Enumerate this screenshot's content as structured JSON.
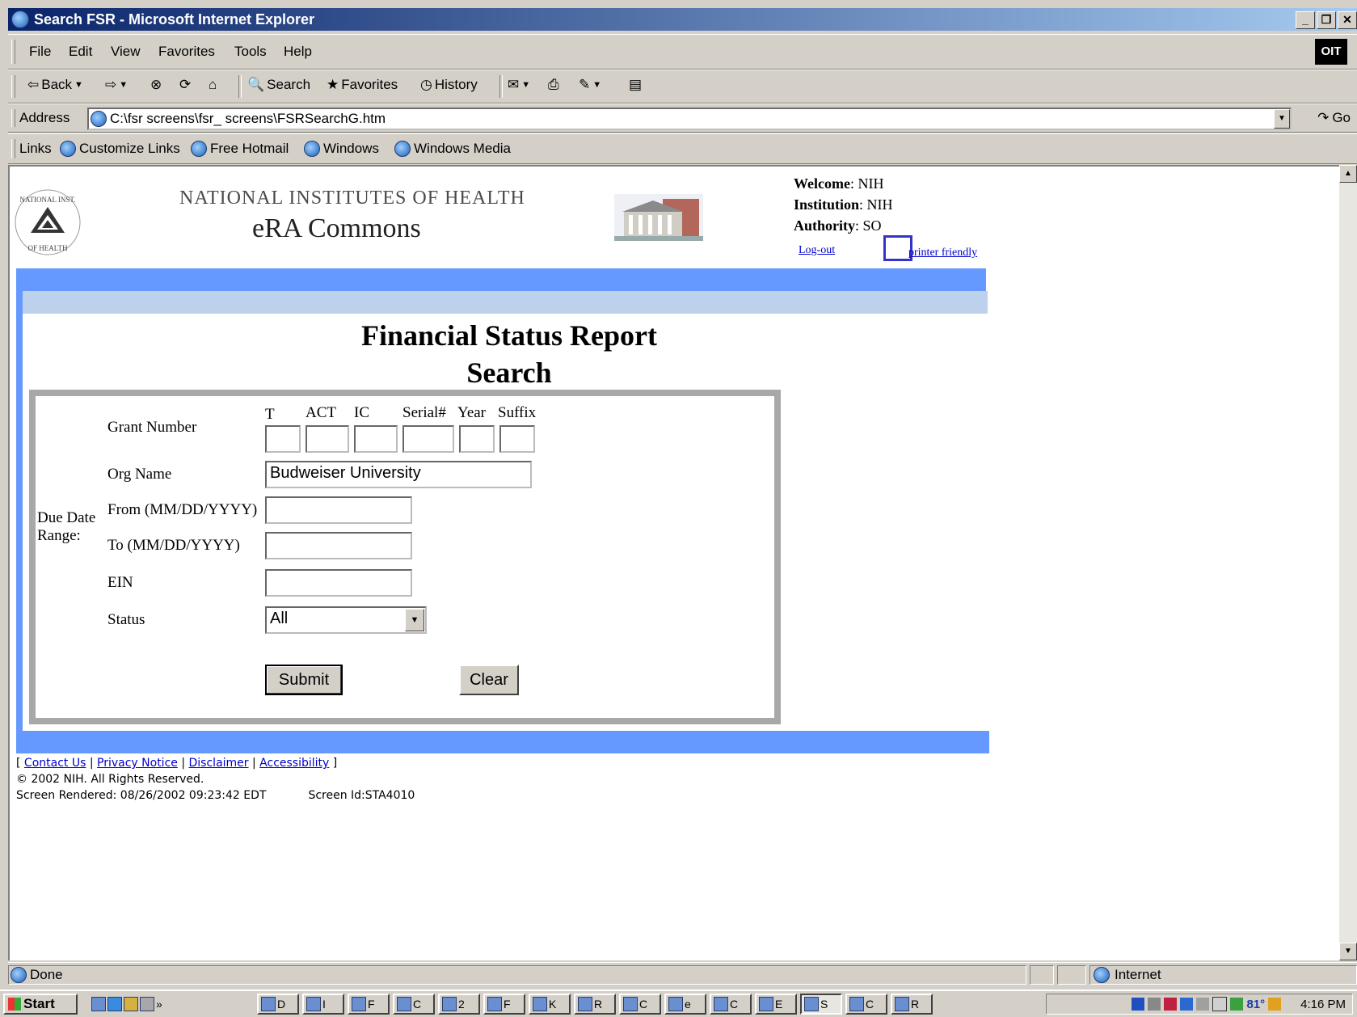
{
  "window": {
    "title": "Search FSR - Microsoft Internet Explorer",
    "controls": [
      "_",
      "❐",
      "✕"
    ]
  },
  "menu": {
    "items": [
      "File",
      "Edit",
      "View",
      "Favorites",
      "Tools",
      "Help"
    ],
    "brand": "OIT"
  },
  "toolbar": {
    "back": "Back",
    "search": "Search",
    "favorites": "Favorites",
    "history": "History"
  },
  "address": {
    "label": "Address",
    "value": "C:\\fsr screens\\fsr_ screens\\FSRSearchG.htm",
    "go": "Go"
  },
  "links": {
    "label": "Links",
    "items": [
      "Customize Links",
      "Free Hotmail",
      "Windows",
      "Windows Media"
    ]
  },
  "header": {
    "org_name": "NATIONAL INSTITUTES OF HEALTH",
    "app_name": "eRA Commons",
    "welcome_label": "Welcome",
    "welcome_value": "NIH",
    "institution_label": "Institution",
    "institution_value": "NIH",
    "authority_label": "Authority",
    "authority_value": "SO",
    "logout": "Log-out",
    "printer": "printer friendly"
  },
  "form": {
    "title_line1": "Financial Status Report",
    "title_line2": "Search",
    "grant_label": "Grant Number",
    "grant_headers": [
      "T",
      "ACT",
      "IC",
      "Serial#",
      "Year",
      "Suffix"
    ],
    "org_label": "Org Name",
    "org_value": "Budweiser University",
    "due_date_label_1": "Due Date",
    "due_date_label_2": "Range:",
    "from_label": "From (MM/DD/YYYY)",
    "to_label": "To (MM/DD/YYYY)",
    "ein_label": "EIN",
    "status_label": "Status",
    "status_value": "All",
    "submit": "Submit",
    "clear": "Clear"
  },
  "footer": {
    "contact": "Contact Us",
    "privacy": "Privacy Notice",
    "disclaimer": "Disclaimer",
    "accessibility": "Accessibility",
    "copyright": "© 2002 NIH. All Rights Reserved.",
    "rendered": "Screen Rendered: 08/26/2002 09:23:42 EDT",
    "screen_id": "Screen Id:STA4010"
  },
  "status": {
    "text": "Done",
    "zone": "Internet"
  },
  "taskbar": {
    "start": "Start",
    "chevron": "»",
    "tasks": [
      "D",
      "I",
      "F",
      "C",
      "2",
      "F",
      "K",
      "R",
      "C",
      "e",
      "C",
      "E",
      "S",
      "C",
      "R"
    ],
    "temp": "81°",
    "time": "4:16 PM"
  }
}
